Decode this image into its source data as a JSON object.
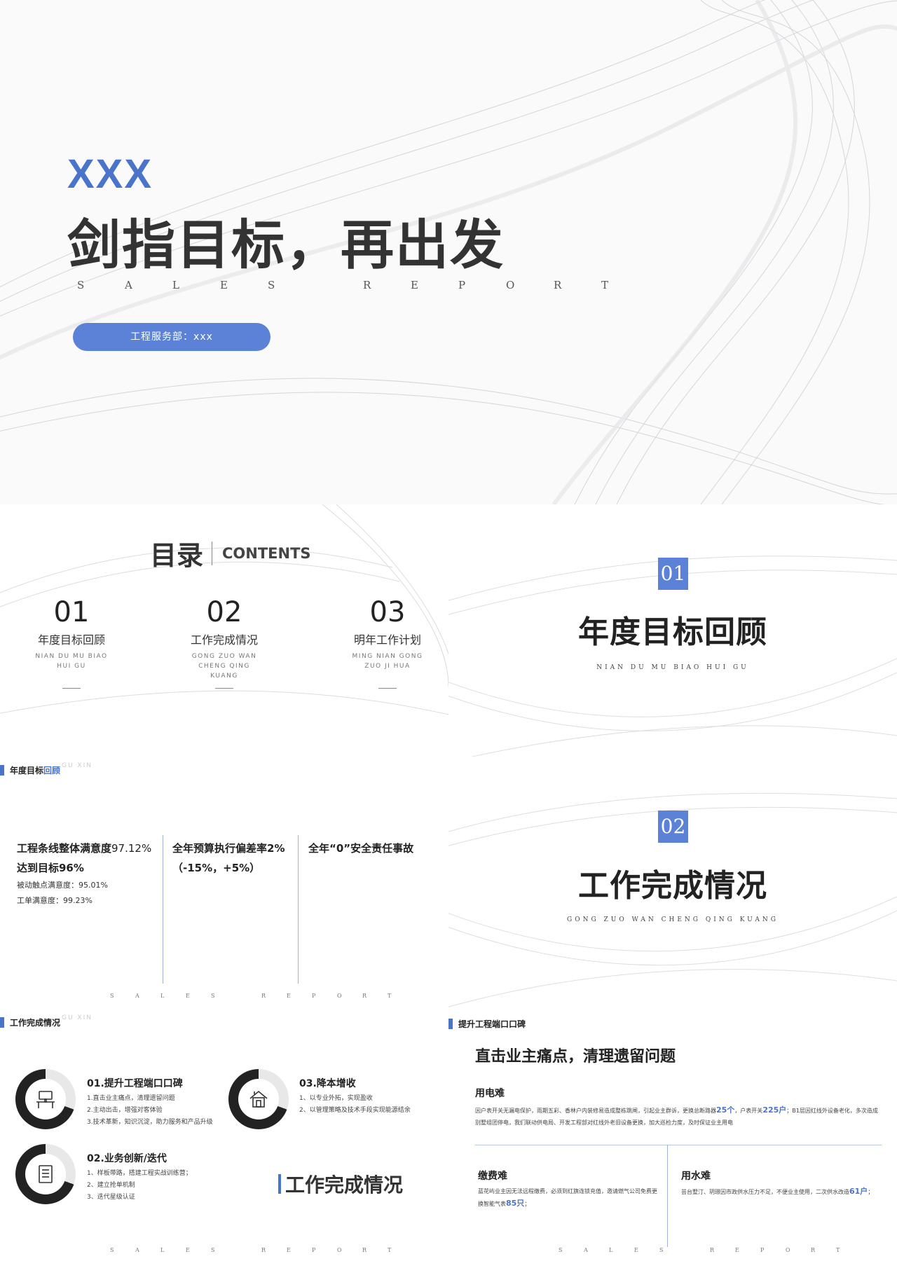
{
  "cover": {
    "brand": "XXX",
    "title": "剑指目标，再出发",
    "subtitle_letters": [
      "S",
      "A",
      "L",
      "E",
      "S",
      "",
      "R",
      "E",
      "P",
      "O",
      "R",
      "T"
    ],
    "department": "工程服务部：xxx"
  },
  "toc": {
    "title": "目录",
    "title_en": "CONTENTS",
    "items": [
      {
        "num": "01",
        "label": "年度目标回顾",
        "pinyin": "NIAN DU MU BIAO HUI GU"
      },
      {
        "num": "02",
        "label": "工作完成情况",
        "pinyin": "GONG ZUO WAN CHENG QING KUANG"
      },
      {
        "num": "03",
        "label": "明年工作计划",
        "pinyin": "MING NIAN GONG ZUO JI HUA"
      }
    ]
  },
  "section1": {
    "num": "01",
    "title": "年度目标回顾",
    "pinyin": "NIAN   DU   MU   BIAO   HUI   GU"
  },
  "section2": {
    "num": "02",
    "title": "工作完成情况",
    "pinyin": "GONG  ZUO  WAN  CHENG  QING  KUANG"
  },
  "target": {
    "header_plain": "年度目标",
    "header_blue": "回顾",
    "header_ghost": "GU  XIN",
    "col1_line1_a": "工程条线整体满意度",
    "col1_line1_b": "97.12%",
    "col1_line2": "达到目标96%",
    "col1_detail1": "被动触点满意度：95.01%",
    "col1_detail2": "工单满意度：99.23%",
    "col2_line1": "全年预算执行偏差率2%",
    "col2_line2": "（-15%，+5%）",
    "col3_line1": "全年“0”安全责任事故",
    "footer_letters": [
      "S",
      "A",
      "L",
      "E",
      "S",
      "",
      "R",
      "E",
      "P",
      "O",
      "R",
      "T"
    ]
  },
  "work": {
    "header": "工作完成情况",
    "header_ghost": "GU  XIN",
    "item1": {
      "title": "01.提升工程端口口碑",
      "lines": [
        "1.直击业主痛点，清理遗留问题",
        "2.主动出击，增强对客体验",
        "3.技术革新，知识沉淀，助力服务和产品升级"
      ],
      "icon": "desk-icon"
    },
    "item2": {
      "title": "02.业务创新/迭代",
      "lines": [
        "1、样板带路，搭建工程实战训练营；",
        "2、建立抢单机制",
        "3、迭代星级认证"
      ],
      "icon": "document-icon"
    },
    "item3": {
      "title": "03.降本增收",
      "lines": [
        "1、以专业外拓，实现盈收",
        "2、以管理策略及技术手段实现能源结余"
      ],
      "icon": "house-icon"
    },
    "big_title": "工作完成情况",
    "footer_letters": [
      "S",
      "A",
      "L",
      "E",
      "S",
      "",
      "R",
      "E",
      "P",
      "O",
      "R",
      "T"
    ]
  },
  "rep": {
    "header": "提升工程端口口碑",
    "headline": "直击业主痛点，清理遗留问题",
    "electric": {
      "title": "用电难",
      "text_a": "因户表开关无漏电保护，雨期五彩、香林户内装修易造成整栋跳闸，引起业主群诉，更换总断路器",
      "num_a": "25个",
      "text_b": "，户表开关",
      "num_b": "225户",
      "text_c": "；B1层因红线外设备老化，多次造成别墅组团停电，我们联动供电局、开发工程部对红线外老旧设备更换，加大巡检力度，及时保证业主用电"
    },
    "fee": {
      "title": "缴费难",
      "text_a": "蓝花屿业主因无法远程缴费，必须到红旗连锁充值，邀请燃气公司免费更换智能气表",
      "num_a": "85只",
      "text_b": "；"
    },
    "water": {
      "title": "用水难",
      "text_a": "芸台墅汀、玥璟因市政供水压力不足，不便业主使用，二次供水改造",
      "num_a": "61户",
      "text_b": "；"
    },
    "footer_letters": [
      "S",
      "A",
      "L",
      "E",
      "S",
      "",
      "R",
      "E",
      "P",
      "O",
      "R",
      "T"
    ]
  },
  "colors": {
    "accent": "#4a74c9",
    "pill": "#5b82d6",
    "text": "#222222"
  }
}
